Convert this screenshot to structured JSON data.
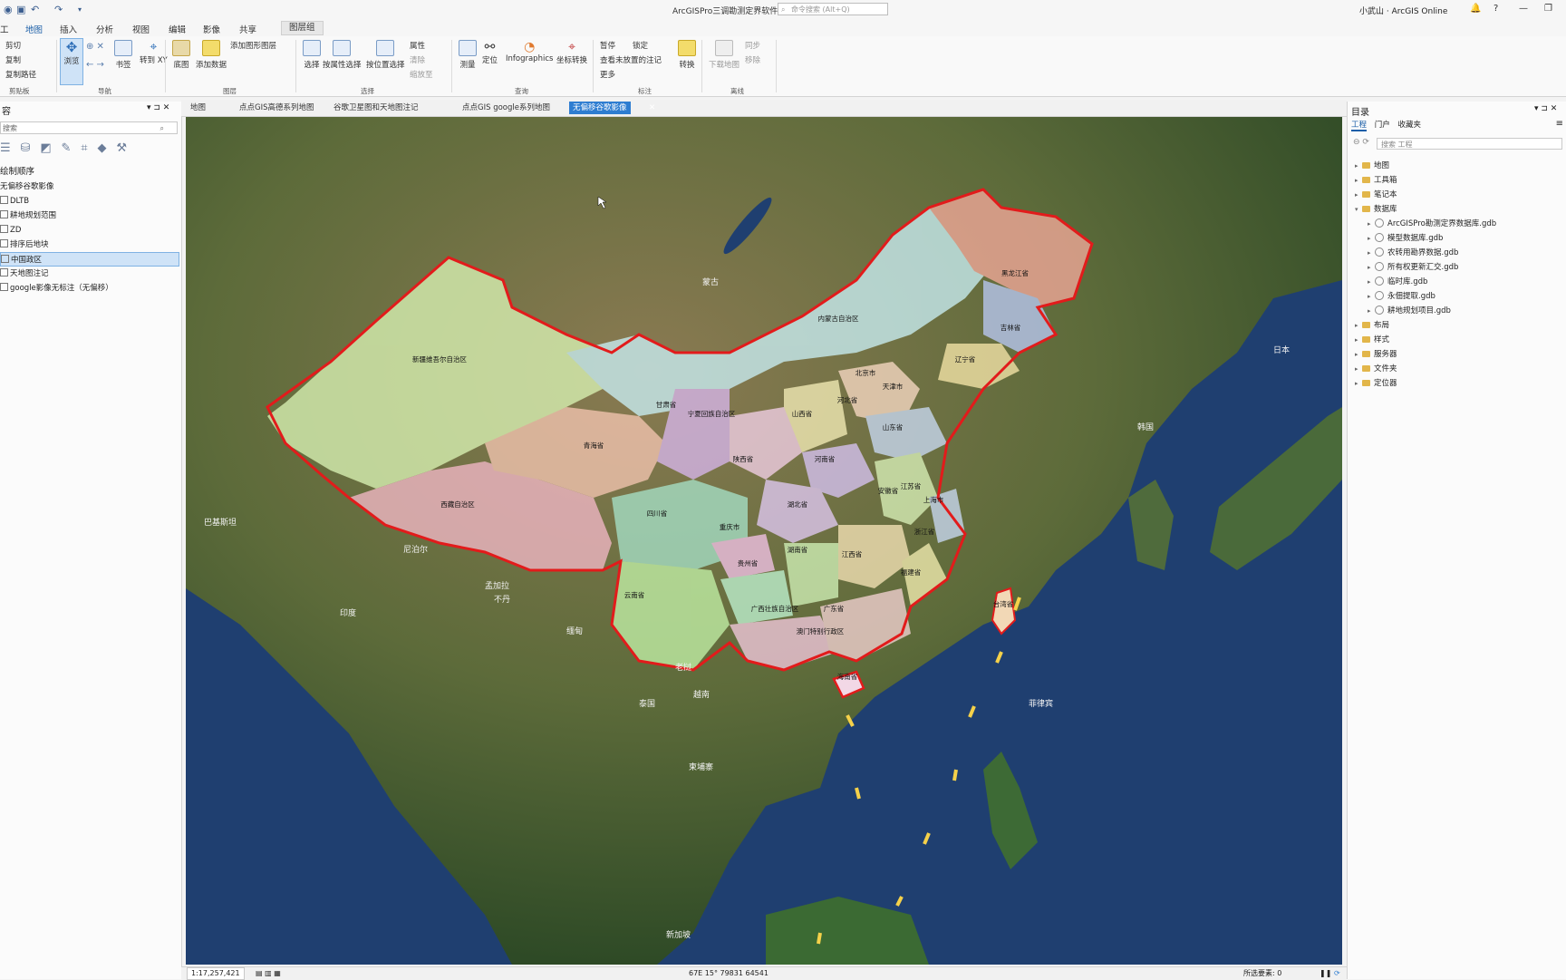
{
  "titlebar": {
    "title": "ArcGISPro三调勘测定界软件",
    "search_placeholder": "命令搜索 (Alt+Q)",
    "user": "小武山 · ArcGIS Online"
  },
  "ribbon_tabs": [
    "地图",
    "插入",
    "分析",
    "视图",
    "编辑",
    "影像",
    "共享"
  ],
  "ribbon_active_tab": "地图",
  "ribbon_context_tab": "图层组",
  "ribbon": {
    "clipboard": {
      "paste_items": [
        "剪切",
        "复制",
        "复制路径"
      ],
      "group": "剪贴板"
    },
    "navigate": {
      "explore": "浏览",
      "bookmarks": "书签",
      "goto": "转到 XY",
      "group": "导航"
    },
    "layer": {
      "basemap": "底图",
      "add_data": "添加数据",
      "add_preset": "添加图形图层",
      "group": "图层"
    },
    "selection": {
      "select": "选择",
      "by_attr": "按属性选择",
      "by_loc": "按位置选择",
      "attr": "属性",
      "clear": "清除",
      "zoom": "缩放至",
      "group": "选择"
    },
    "inquiry": {
      "measure": "测量",
      "locate": "定位",
      "infographics": "Infographics",
      "coordinate": "坐标转换",
      "group": "查询"
    },
    "labeling": {
      "pause": "暂停",
      "lock": "锁定",
      "view_unplaced": "查看未放置的注记",
      "more": "更多",
      "convert": "转换",
      "group": "标注"
    },
    "offline": {
      "download": "下载地图",
      "sync": "同步",
      "remove": "移除",
      "group": "离线"
    }
  },
  "contents_pane": {
    "search_placeholder": "搜索",
    "heading": "绘制顺序",
    "layers": [
      "无偏移谷歌影像",
      "DLTB",
      "耕地规划范围",
      "ZD",
      "排序后地块",
      "中国政区",
      "天地图注记",
      "google影像无标注（无偏移）"
    ],
    "selected_index": 5
  },
  "map_tabs": [
    "地图",
    "点点GIS高德系列地图",
    "谷歌卫星图和天地图注记",
    "点点GIS google系列地图",
    "无偏移谷歌影像"
  ],
  "map_active_tab": 4,
  "provinces": [
    "新疆维吾尔自治区",
    "西藏自治区",
    "青海省",
    "甘肃省",
    "内蒙古自治区",
    "黑龙江省",
    "吉林省",
    "辽宁省",
    "北京市",
    "天津市",
    "河北省",
    "山西省",
    "山东省",
    "宁夏回族自治区",
    "陕西省",
    "河南省",
    "江苏省",
    "上海市",
    "安徽省",
    "湖北省",
    "四川省",
    "重庆市",
    "浙江省",
    "贵州省",
    "湖南省",
    "江西省",
    "福建省",
    "云南省",
    "广西壮族自治区",
    "广东省",
    "台湾省",
    "澳门特别行政区",
    "海南省"
  ],
  "geo_labels": [
    "蒙古",
    "印度",
    "孟加拉",
    "缅甸",
    "老挝",
    "泰国",
    "越南",
    "柬埔寨",
    "菲律宾",
    "巴基斯坦",
    "尼泊尔",
    "不丹",
    "日本",
    "韩国",
    "新加坡"
  ],
  "statusbar": {
    "scale": "1:17,257,421",
    "coords": "67E 15° 79831 64541",
    "selected": "所选要素: 0"
  },
  "catalog": {
    "title": "目录",
    "tabs": [
      "工程",
      "门户",
      "收藏夹"
    ],
    "search_placeholder": "搜索 工程",
    "items": [
      "地图",
      "工具箱",
      "笔记本",
      "数据库"
    ],
    "db_children": [
      "ArcGISPro勘测定界数据库.gdb",
      "模型数据库.gdb",
      "农转用勘界数据.gdb",
      "所有权更新汇交.gdb",
      "临时库.gdb",
      "永佃提取.gdb",
      "耕地规划项目.gdb"
    ],
    "more_items": [
      "布局",
      "样式",
      "服务器",
      "文件夹",
      "定位器"
    ]
  }
}
